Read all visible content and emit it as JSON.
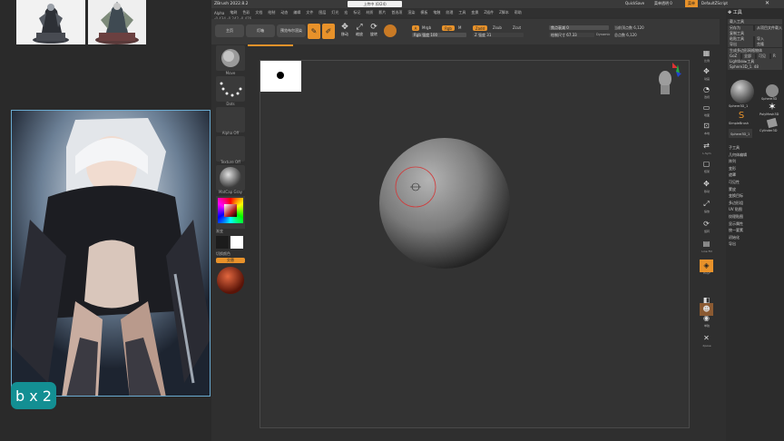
{
  "reference_panel": {
    "badge": "b x 2"
  },
  "window": {
    "title": "ZBrush 2022.8.2",
    "title_right": [
      "QuickSave",
      "菜单透明 0",
      "菜单",
      "DefaultZScript"
    ],
    "center_note": "上传中 (0/24)"
  },
  "menubar": {
    "items": [
      "Alpha",
      "笔刷",
      "色彩",
      "文档",
      "绘制",
      "动态",
      "编辑",
      "文件",
      "图层",
      "灯光",
      "宏",
      "标记",
      "材质",
      "影片",
      "首选项",
      "渲染",
      "模板",
      "笔触",
      "纹理",
      "工具",
      "变换",
      "Z插件",
      "Z脚本",
      "帮助"
    ],
    "coords": "-0.434,-0.242,-0.476"
  },
  "toolbar": {
    "home_label": "主页",
    "lightbox_label": "灯箱",
    "preview_label": "预览布尔渲染",
    "edit_label": "编辑",
    "draw_label": "绘制",
    "move_label": "移动",
    "scale_label": "缩放",
    "rotate_label": "旋转",
    "mrgb_label": "Mrgb",
    "rgb_label": "Rgb",
    "m_label": "M",
    "zadd_label": "Zadd",
    "zsub_label": "Zsub",
    "zcut_label": "Zcut",
    "rgb_intensity": "Rgb 强度 100",
    "z_intensity": "Z 强度 31",
    "focal_shift": "焦点衰减 0",
    "draw_size": "绘制尺寸 67.33",
    "dynamic": "Dynamic",
    "active_points": "当前顶点数 6,120",
    "total_points": "总点数 6,120"
  },
  "shelf": {
    "brush_label": "Move",
    "stroke_label": "Dots",
    "alpha_label": "Alpha Off",
    "texture_label": "Texture Off",
    "material_label": "MatCap Gray",
    "gradient_label": "渐变",
    "switch_label": "切换颜色",
    "alternate_label": "交替"
  },
  "right_shelf": {
    "labels": [
      "比例",
      "动画",
      "透视",
      "地面",
      "本地",
      "L.Sym",
      "框架",
      "移动",
      "缩放",
      "旋转",
      "Line Fill",
      "PolyF",
      "透明",
      "单独",
      "Xpose"
    ]
  },
  "palette": {
    "header": "工具",
    "rows": [
      "载入工具",
      "另存为",
      "从项目文件载入工具",
      "复制工具",
      "粘贴工具",
      "导入",
      "导出",
      "克隆",
      "生成多边形网格物体",
      "GoZ",
      "全部",
      "可见",
      "R",
      "Lightbox▸工具",
      "Sphere3D_1. 48"
    ],
    "tools": [
      {
        "name": "Sphere3D_1"
      },
      {
        "name": "Sphere3D"
      },
      {
        "name": "PolyMesh3D"
      },
      {
        "name": "SimpleBrush"
      },
      {
        "name": "Cylinder3D"
      },
      {
        "name": "Sphere3D_1"
      }
    ],
    "subpalettes": [
      "子工具",
      "几何体编辑",
      "阵列",
      "变形",
      "遮罩",
      "可见性",
      "蒙皮",
      "变换目标",
      "多边形组",
      "UV 贴图",
      "纹理贴图",
      "显示属性",
      "统一要素",
      "初始化",
      "导出"
    ]
  },
  "colors": {
    "accent_orange": "#e8922a",
    "badge_teal": "#138f93",
    "brush_ring": "#d23a3a"
  }
}
